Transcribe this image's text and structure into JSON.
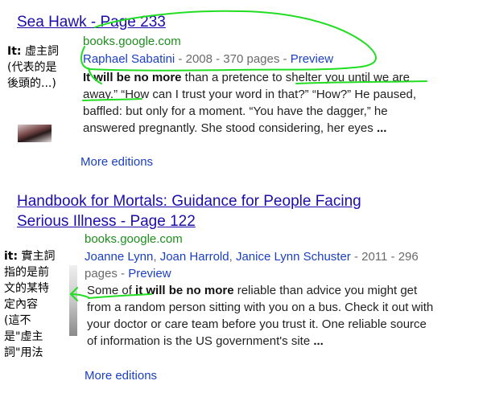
{
  "results": [
    {
      "title": "Sea Hawk - Page 233",
      "url": "books.google.com",
      "authors": [
        "Raphael Sabatini"
      ],
      "meta_after": " - 2008 - 370 pages - ",
      "preview": "Preview",
      "snippet": {
        "bold_lead": "It will be no more",
        "text1": " than a pretence to shelter you until we are away.” “How can I trust your word in that?” “How?” He paused, baffled: but only for a moment. “You have the dagger,” he answered pregnantly. She stood considering, her eyes ",
        "ellipsis": "..."
      },
      "more_editions": "More editions"
    },
    {
      "title_line1": "Handbook for Mortals: Guidance for People Facing",
      "title_line2": "Serious Illness - Page 122",
      "url": "books.google.com",
      "authors": [
        "Joanne Lynn",
        "Joan Harrold",
        "Janice Lynn Schuster"
      ],
      "meta_after": " - 2011 - 296 pages - ",
      "preview": "Preview",
      "snippet": {
        "lead": "Some of ",
        "bold_lead": "it will be no more",
        "text1": " reliable than advice you might get from a random person sitting with you on a bus. Check it out with your doctor or care team before you trust it. One reliable source of information is the US government's site ",
        "ellipsis": "..."
      },
      "more_editions": "More editions"
    }
  ],
  "annotations": {
    "note1": {
      "label": "It:",
      "text": " 虛主詞",
      "line2": "(代表的是",
      "line3": "後頭的...)"
    },
    "note2": {
      "label": "it:",
      "text": " 實主詞",
      "lines": [
        "指的是前",
        "文的某特",
        "定內容",
        "(這不",
        "是\"虛主",
        "詞\"用法"
      ]
    },
    "stroke_color": "#22dd22"
  }
}
